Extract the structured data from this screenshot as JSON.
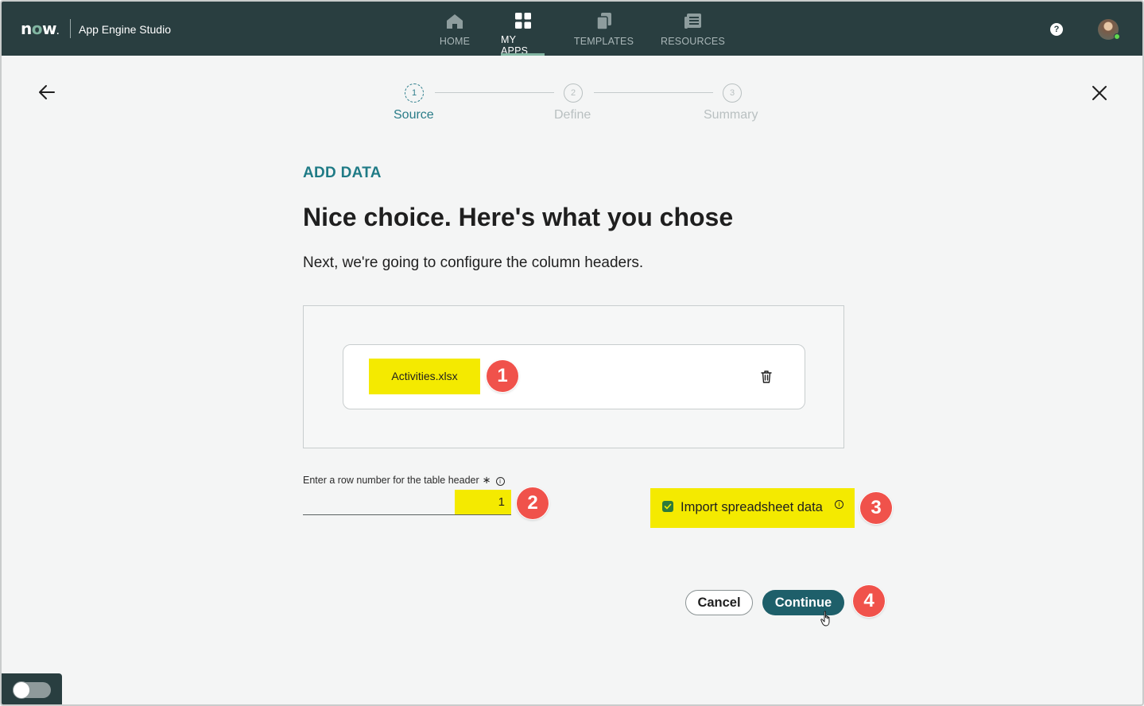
{
  "header": {
    "logo": "now",
    "app_name": "App Engine Studio",
    "nav": [
      {
        "label": "HOME",
        "icon": "home-icon"
      },
      {
        "label": "MY APPS",
        "icon": "grid-icon",
        "active": true
      },
      {
        "label": "TEMPLATES",
        "icon": "templates-icon"
      },
      {
        "label": "RESOURCES",
        "icon": "resources-icon"
      }
    ],
    "help": "?"
  },
  "stepper": {
    "steps": [
      {
        "number": "1",
        "label": "Source",
        "active": true
      },
      {
        "number": "2",
        "label": "Define"
      },
      {
        "number": "3",
        "label": "Summary"
      }
    ]
  },
  "content": {
    "eyebrow": "ADD DATA",
    "headline": "Nice choice. Here's what you chose",
    "subline": "Next, we're going to configure the column headers.",
    "file_name": "Activities.xlsx",
    "row_label": "Enter a row number for the table header",
    "row_required": "∗",
    "row_value": "1",
    "import_label": "Import spreadsheet data",
    "import_checked": true,
    "cancel_label": "Cancel",
    "continue_label": "Continue"
  },
  "annotations": [
    "1",
    "2",
    "3",
    "4"
  ],
  "colors": {
    "topbar": "#293e40",
    "accent": "#81b5a1",
    "primary_button": "#1e5f6a",
    "highlight": "#f4ea00",
    "badge": "#f0524b"
  }
}
